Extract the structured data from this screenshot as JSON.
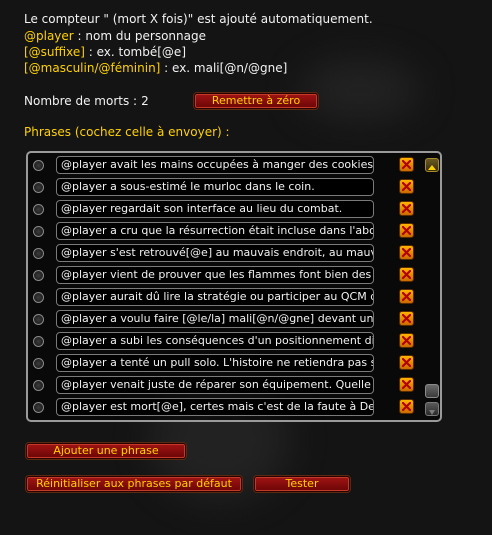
{
  "info": {
    "line1": "Le compteur \" (mort X fois)\" est ajouté automatiquement.",
    "line2_token": "@player",
    "line2_rest": " : nom du personnage",
    "line3_token": "[@suffixe]",
    "line3_rest": " : ex. tombé[@e]",
    "line4_token": "[@masculin/@féminin]",
    "line4_rest": " : ex. mali[@n/@gne]"
  },
  "counter": {
    "label": "Nombre de morts :",
    "value": "2",
    "reset_label": "Remettre à zéro"
  },
  "phrases": {
    "title": "Phrases (cochez celle à envoyer) :",
    "items": [
      "@player avait les mains occupées à manger des cookies au m",
      "@player a sous-estimé le murloc dans le coin.",
      "@player regardait son interface au lieu du combat.",
      "@player a cru que la résurrection était incluse dans l'abonnem",
      "@player s'est retrouvé[@e] au mauvais endroit, au mauvais mo",
      "@player vient de prouver que les flammes font bien des dégâts",
      "@player aurait dû lire la stratégie ou participer au QCM du jeud",
      "@player a voulu faire [@le/la] mali[@n/@gne] devant un pack d",
      "@player a subi les conséquences d'un positionnement disons..",
      "@player a tenté un pull solo. L'histoire ne retiendra pas son no",
      "@player venait juste de réparer son équipement. Quelle ironie.",
      "@player est mort[@e], certes mais c'est de la faute à Denadel."
    ]
  },
  "buttons": {
    "add_phrase": "Ajouter une phrase",
    "reset_defaults": "Réinitialiser aux phrases par défaut",
    "test": "Tester"
  },
  "colors": {
    "gold": "#ffd200",
    "button_red": "#8c0c0c",
    "delete_orange": "#f0a000"
  },
  "icons": {
    "delete": "close-x-icon",
    "scroll_up": "scroll-up-arrow-icon",
    "scroll_down": "scroll-down-arrow-icon"
  }
}
